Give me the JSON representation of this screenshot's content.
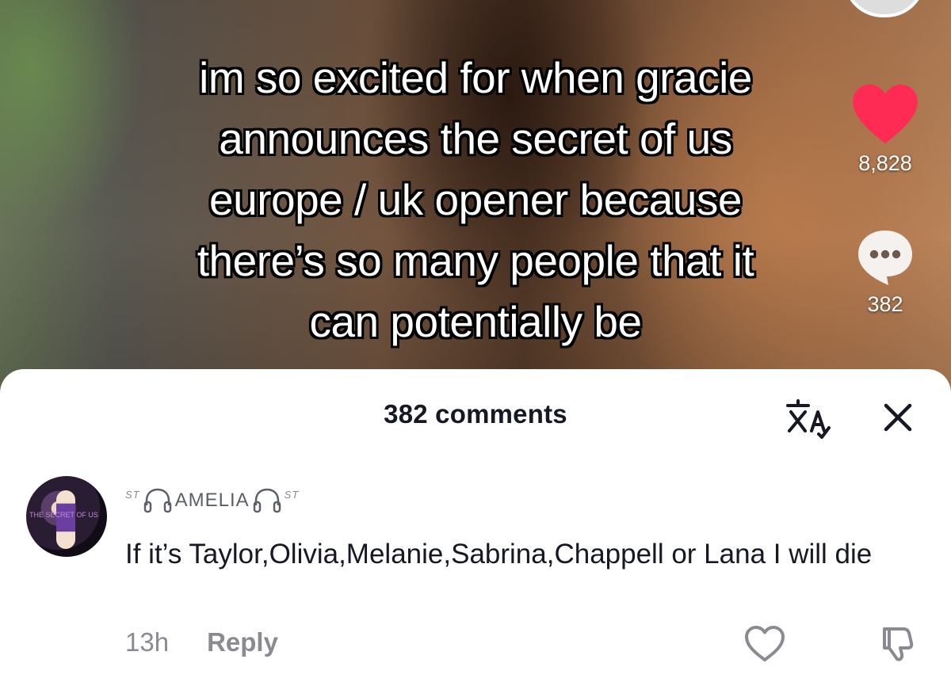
{
  "video": {
    "caption_lines": [
      "im so excited for when gracie",
      "announces the secret of us",
      "europe / uk opener because",
      "there’s so many people that it",
      "can potentially be"
    ],
    "like_count": "8,828",
    "comment_count": "382"
  },
  "sheet": {
    "title": "382 comments"
  },
  "comment": {
    "username": "AMELIA",
    "username_prefix": "ST",
    "username_suffix": "ST",
    "avatar_text": "THE SECRET OF US",
    "text": "If it’s Taylor,Olivia,Melanie,Sabrina,Chappell or Lana I will die",
    "time": "13h",
    "reply_label": "Reply"
  },
  "colors": {
    "like_red": "#FE2C55",
    "text_primary": "#161823",
    "text_secondary": "#8A8B91"
  },
  "icons": {
    "like": "heart-icon",
    "comment": "comment-bubble-icon",
    "translate": "translate-icon",
    "close": "close-icon",
    "headphones": "headphones-icon",
    "comment_like": "heart-outline-icon",
    "dislike": "thumbs-down-icon"
  }
}
